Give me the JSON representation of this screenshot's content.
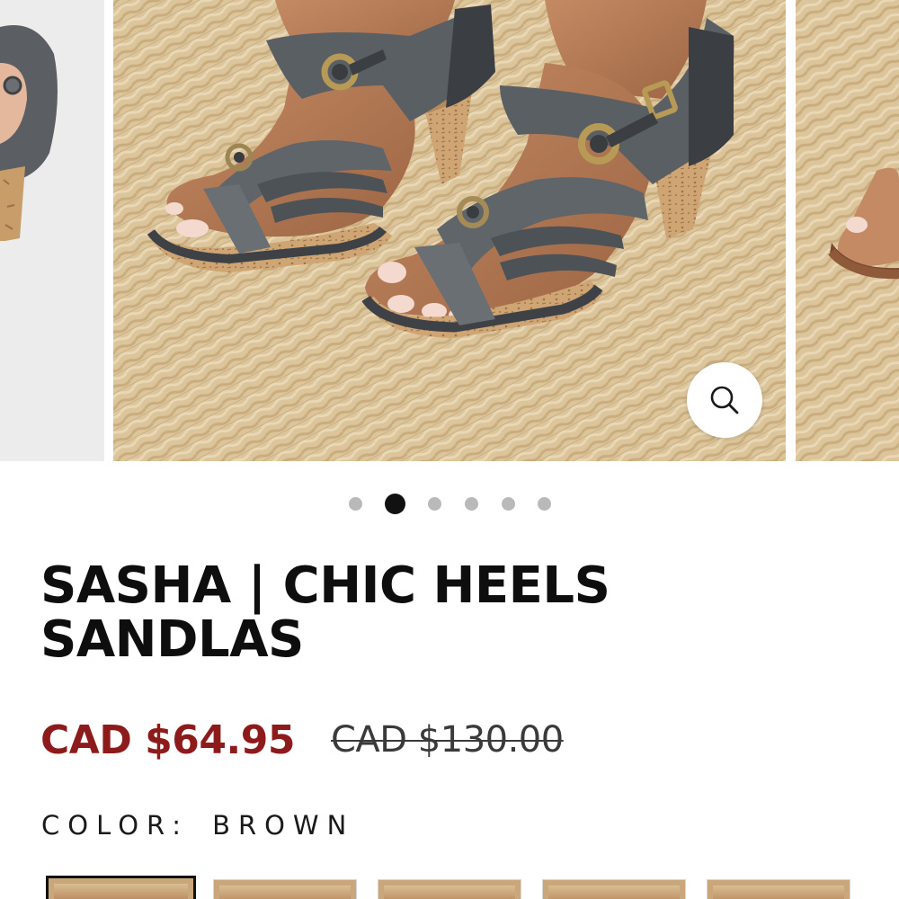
{
  "gallery": {
    "zoom_icon": "search-icon",
    "dots_count": 6,
    "active_dot": 2
  },
  "product": {
    "title_line1": "SASHA | CHIC HEELS",
    "title_line2": "SANDLAS",
    "sale_price": "CAD $64.95",
    "compare_price": "CAD $130.00"
  },
  "color": {
    "label": "COLOR:",
    "value": "BROWN"
  },
  "swatches": {
    "count": 5,
    "selected_index": 1
  },
  "colors": {
    "sale_price": "#8e1b1b",
    "text": "#0e0e0e",
    "active_dot": "#111111",
    "inactive_dot": "#b9b9b9"
  }
}
